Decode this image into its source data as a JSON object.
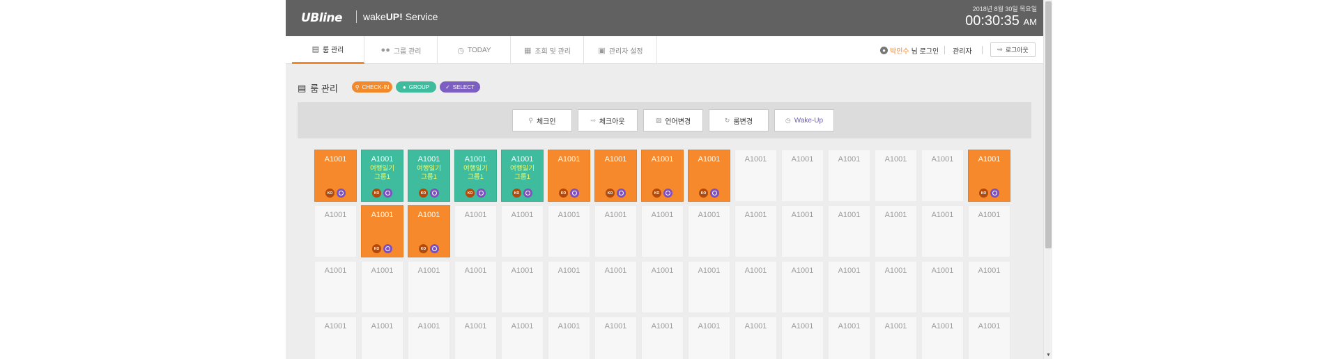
{
  "header": {
    "logo": "UBline",
    "service_prefix": "wake",
    "service_bold": "UP!",
    "service_suffix": " Service",
    "date": "2018년 8월 30일 목요일",
    "time": "00:30:35",
    "ampm": "AM"
  },
  "nav": {
    "tabs": [
      {
        "label": "룸 관리",
        "icon": "bed-icon",
        "active": true
      },
      {
        "label": "그룹 관리",
        "icon": "group-icon",
        "active": false
      },
      {
        "label": "TODAY",
        "icon": "clock-icon",
        "active": false
      },
      {
        "label": "조회 및 관리",
        "icon": "calendar-icon",
        "active": false
      },
      {
        "label": "관리자 설정",
        "icon": "window-icon",
        "active": false
      }
    ],
    "user_name": "박인수",
    "user_suffix": "님 로그인",
    "admin_label": "관리자",
    "logout_label": "로그아웃"
  },
  "page": {
    "title": "룸 관리",
    "pills": [
      {
        "label": "CHECK-IN",
        "icon": "key-icon",
        "color": "#f28a2c"
      },
      {
        "label": "GROUP",
        "icon": "group-icon",
        "color": "#3fbc9e"
      },
      {
        "label": "SELECT",
        "icon": "check-icon",
        "color": "#7d5fc4"
      }
    ]
  },
  "actions": [
    {
      "label": "체크인",
      "icon": "key-icon"
    },
    {
      "label": "체크아웃",
      "icon": "exit-icon"
    },
    {
      "label": "언어변경",
      "icon": "language-icon"
    },
    {
      "label": "룸변경",
      "icon": "refresh-icon"
    },
    {
      "label": "Wake-Up",
      "icon": "clock-icon"
    }
  ],
  "room_label": "A1001",
  "group_label": [
    "여행일기",
    "그룹1"
  ],
  "badge_text": "KO",
  "colors": {
    "orange": "#f6892c",
    "teal": "#3fbc9e",
    "purple": "#7d4fc0",
    "header": "#616161"
  },
  "rooms": [
    [
      "orange",
      "teal",
      "teal",
      "teal",
      "teal",
      "orange",
      "orange",
      "orange",
      "orange",
      "empty",
      "empty",
      "empty",
      "empty",
      "empty",
      "orange"
    ],
    [
      "empty",
      "orange",
      "orange",
      "empty",
      "empty",
      "empty",
      "empty",
      "empty",
      "empty",
      "empty",
      "empty",
      "empty",
      "empty",
      "empty",
      "empty"
    ],
    [
      "empty",
      "empty",
      "empty",
      "empty",
      "empty",
      "empty",
      "empty",
      "empty",
      "empty",
      "empty",
      "empty",
      "empty",
      "empty",
      "empty",
      "empty"
    ],
    [
      "empty",
      "empty",
      "empty",
      "empty",
      "empty",
      "empty",
      "empty",
      "empty",
      "empty",
      "empty",
      "empty",
      "empty",
      "empty",
      "empty",
      "empty"
    ]
  ]
}
